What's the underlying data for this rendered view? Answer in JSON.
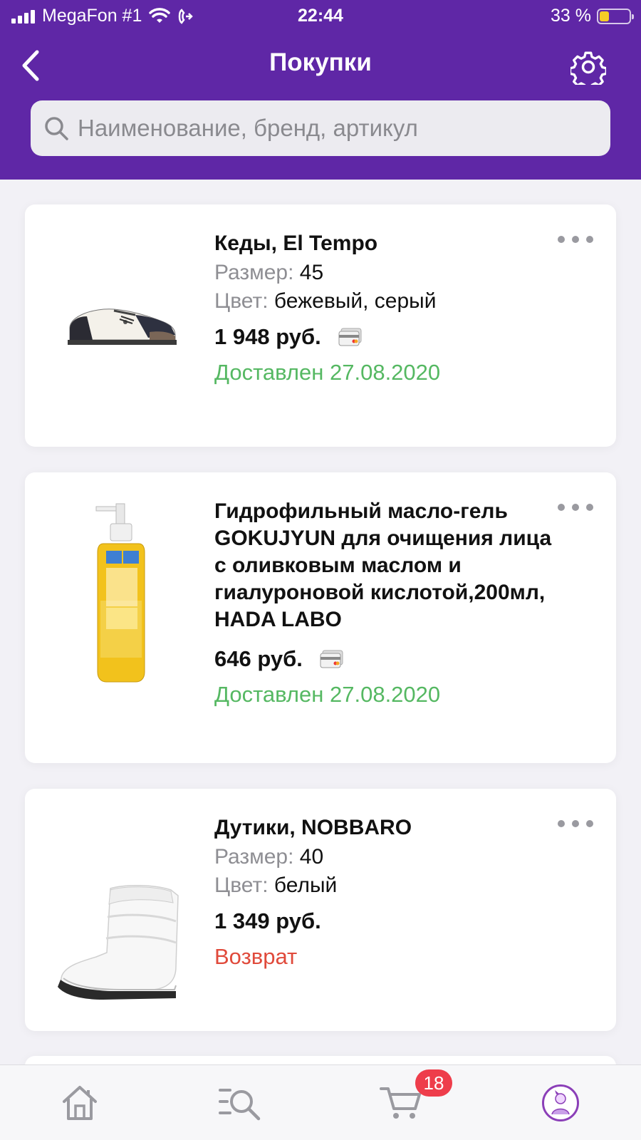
{
  "status_bar": {
    "carrier": "MegaFon #1",
    "time": "22:44",
    "battery_percent": "33 %",
    "battery_level": 0.33,
    "icons": [
      "signal-icon",
      "wifi-icon",
      "call-forwarding-icon",
      "battery-icon"
    ]
  },
  "header": {
    "title": "Покупки",
    "back_icon": "chevron-left-icon",
    "settings_icon": "gear-icon",
    "background_color": "#5f27a6"
  },
  "search": {
    "placeholder": "Наименование, бренд, артикул",
    "value": "",
    "icon": "search-icon"
  },
  "purchases": [
    {
      "title": "Кеды, El Tempo",
      "size_label": "Размер:",
      "size": "45",
      "color_label": "Цвет:",
      "color": "бежевый, серый",
      "price": "1 948 руб.",
      "payment_icon": "card-icon",
      "status": "Доставлен 27.08.2020",
      "status_type": "delivered",
      "image_icon": "sneaker-image"
    },
    {
      "title": "Гидрофильный масло-гель GOKUJYUN для очищения лица с оливковым маслом и гиалуроновой кислотой,200мл, HADA LABO",
      "price": "646 руб.",
      "payment_icon": "card-icon",
      "status": "Доставлен 27.08.2020",
      "status_type": "delivered",
      "image_icon": "cleansing-oil-bottle-image"
    },
    {
      "title": "Дутики, NOBBARO",
      "size_label": "Размер:",
      "size": "40",
      "color_label": "Цвет:",
      "color": "белый",
      "price": "1 349 руб.",
      "status": "Возврат",
      "status_type": "returned",
      "image_icon": "snow-boot-image"
    }
  ],
  "colors": {
    "delivered": "#55b862",
    "returned": "#e04a3b",
    "badge": "#ee3d4b"
  },
  "tabbar": {
    "tabs": [
      "home-icon",
      "catalog-search-icon",
      "cart-icon",
      "profile-avatar"
    ],
    "cart_badge": "18"
  }
}
